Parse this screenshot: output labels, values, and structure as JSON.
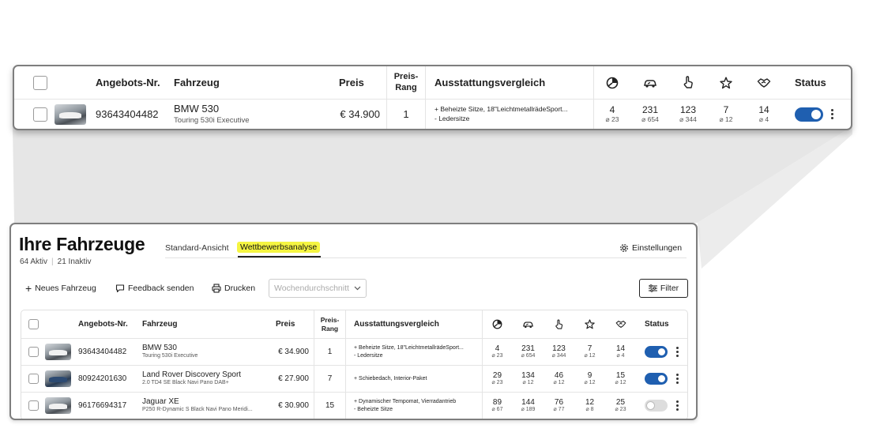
{
  "page": {
    "title": "Ihre Fahrzeuge",
    "counts": {
      "active": "64 Aktiv",
      "inactive": "21 Inaktiv"
    },
    "tabs": [
      {
        "label": "Standard-Ansicht",
        "active": false
      },
      {
        "label": "Wettbewerbsanalyse",
        "active": true
      }
    ],
    "settings_label": "Einstellungen",
    "toolbar": {
      "new_vehicle": "Neues Fahrzeug",
      "feedback": "Feedback senden",
      "print": "Drucken",
      "period_placeholder": "Wochendurchschnitt",
      "filter": "Filter"
    }
  },
  "table": {
    "headers": {
      "offer_no": "Angebots-Nr.",
      "vehicle": "Fahrzeug",
      "price": "Preis",
      "price_rank_1": "Preis-",
      "price_rank_2": "Rang",
      "equipment": "Ausstattungsvergleich",
      "status": "Status"
    },
    "metric_icons": [
      "pie-chart-icon",
      "car-speed-icon",
      "touch-hand-icon",
      "star-icon",
      "handshake-icon"
    ],
    "rows": [
      {
        "offer_no": "93643404482",
        "vehicle": "BMW 530",
        "variant": "Touring 530i Executive",
        "price": "€ 34.900",
        "rank": "1",
        "equipment": [
          "+ Beheizte Sitze, 18\"LeichtmetallrädeSport...",
          "- Ledersitze"
        ],
        "metrics": [
          {
            "value": "4",
            "avg": "⌀ 23"
          },
          {
            "value": "231",
            "avg": "⌀ 654"
          },
          {
            "value": "123",
            "avg": "⌀ 344"
          },
          {
            "value": "7",
            "avg": "⌀ 12"
          },
          {
            "value": "14",
            "avg": "⌀ 4"
          }
        ],
        "status_on": true
      },
      {
        "offer_no": "80924201630",
        "vehicle": "Land Rover Discovery Sport",
        "variant": "2.0 TD4 SE Black Navi Pano DAB+",
        "price": "€ 27.900",
        "rank": "7",
        "equipment": [
          "+ Schiebedach, Interior-Paket"
        ],
        "metrics": [
          {
            "value": "29",
            "avg": "⌀ 23"
          },
          {
            "value": "134",
            "avg": "⌀ 12"
          },
          {
            "value": "46",
            "avg": "⌀ 12"
          },
          {
            "value": "9",
            "avg": "⌀ 12"
          },
          {
            "value": "15",
            "avg": "⌀ 12"
          }
        ],
        "status_on": true
      },
      {
        "offer_no": "96176694317",
        "vehicle": "Jaguar XE",
        "variant": "P250 R-Dynamic S Black Navi Pano Meridi...",
        "price": "€ 30.900",
        "rank": "15",
        "equipment": [
          "+ Dynamischer Tempomat, Vierradantrieb",
          "- Beheizte Sitze"
        ],
        "metrics": [
          {
            "value": "89",
            "avg": "⌀ 67"
          },
          {
            "value": "144",
            "avg": "⌀ 189"
          },
          {
            "value": "76",
            "avg": "⌀ 77"
          },
          {
            "value": "12",
            "avg": "⌀ 8"
          },
          {
            "value": "25",
            "avg": "⌀ 23"
          }
        ],
        "status_on": false
      }
    ]
  },
  "colors": {
    "accent": "#1f5fb0",
    "highlight": "#f5f542",
    "border": "#7e7e7e",
    "shadow_band": "#e6e6e6"
  }
}
